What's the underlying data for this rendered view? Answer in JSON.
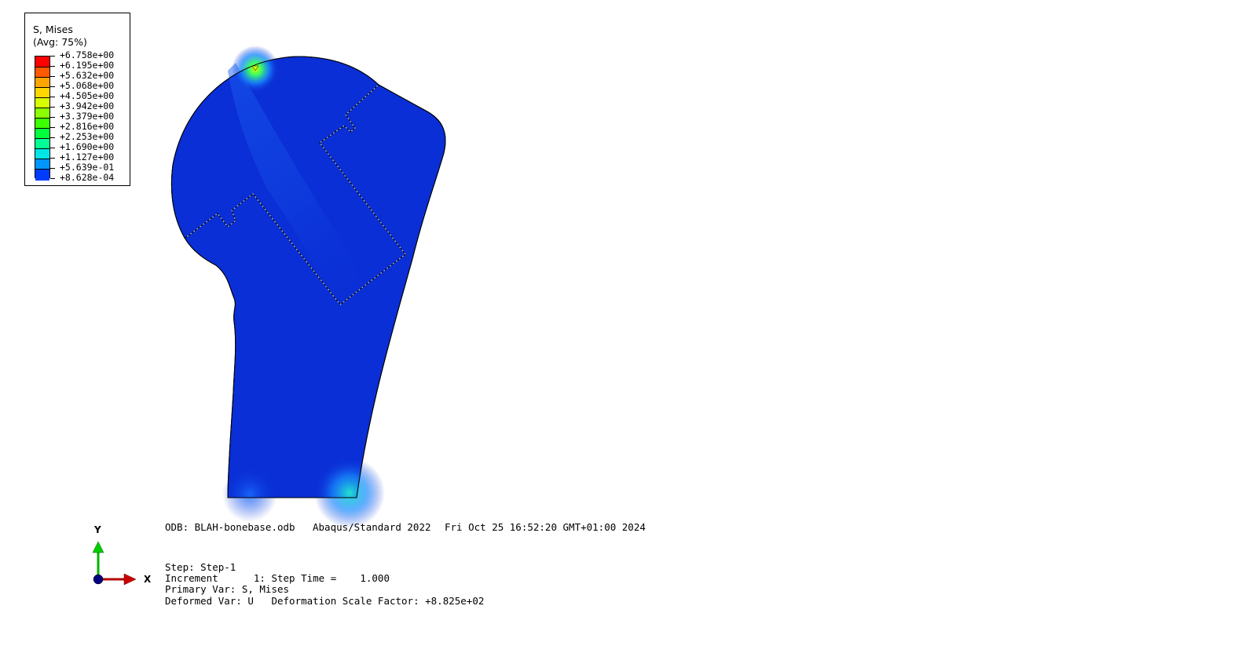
{
  "legend": {
    "title": "S, Mises",
    "subtitle": "(Avg: 75%)",
    "values": [
      "+6.758e+00",
      "+6.195e+00",
      "+5.632e+00",
      "+5.068e+00",
      "+4.505e+00",
      "+3.942e+00",
      "+3.379e+00",
      "+2.816e+00",
      "+2.253e+00",
      "+1.690e+00",
      "+1.127e+00",
      "+5.639e-01",
      "+8.628e-04"
    ],
    "colors": [
      "#ff0000",
      "#ff5a00",
      "#ffa500",
      "#ffd700",
      "#d8ff00",
      "#8cff00",
      "#3cff00",
      "#00ff3c",
      "#00ff96",
      "#00e5e5",
      "#0096ff",
      "#003cff",
      "#0000e0"
    ]
  },
  "model": {
    "base_color": "#0a2fd6",
    "hotspot_color": "#3cff60",
    "secondary_hotspot_color": "#22d6d0"
  },
  "info": {
    "odb": "ODB: BLAH-bonebase.odb",
    "solver": "Abaqus/Standard 2022",
    "date": "Fri Oct 25 16:52:20 GMT+01:00 2024",
    "step": "Step: Step-1",
    "increment": "Increment      1: Step Time =    1.000",
    "primary_var": "Primary Var: S, Mises",
    "deformed_var": "Deformed Var: U   Deformation Scale Factor: +8.825e+02"
  },
  "triad": {
    "x_label": "X",
    "y_label": "Y",
    "x_color": "#b30000",
    "y_color": "#00b300",
    "origin_color": "#000080"
  }
}
